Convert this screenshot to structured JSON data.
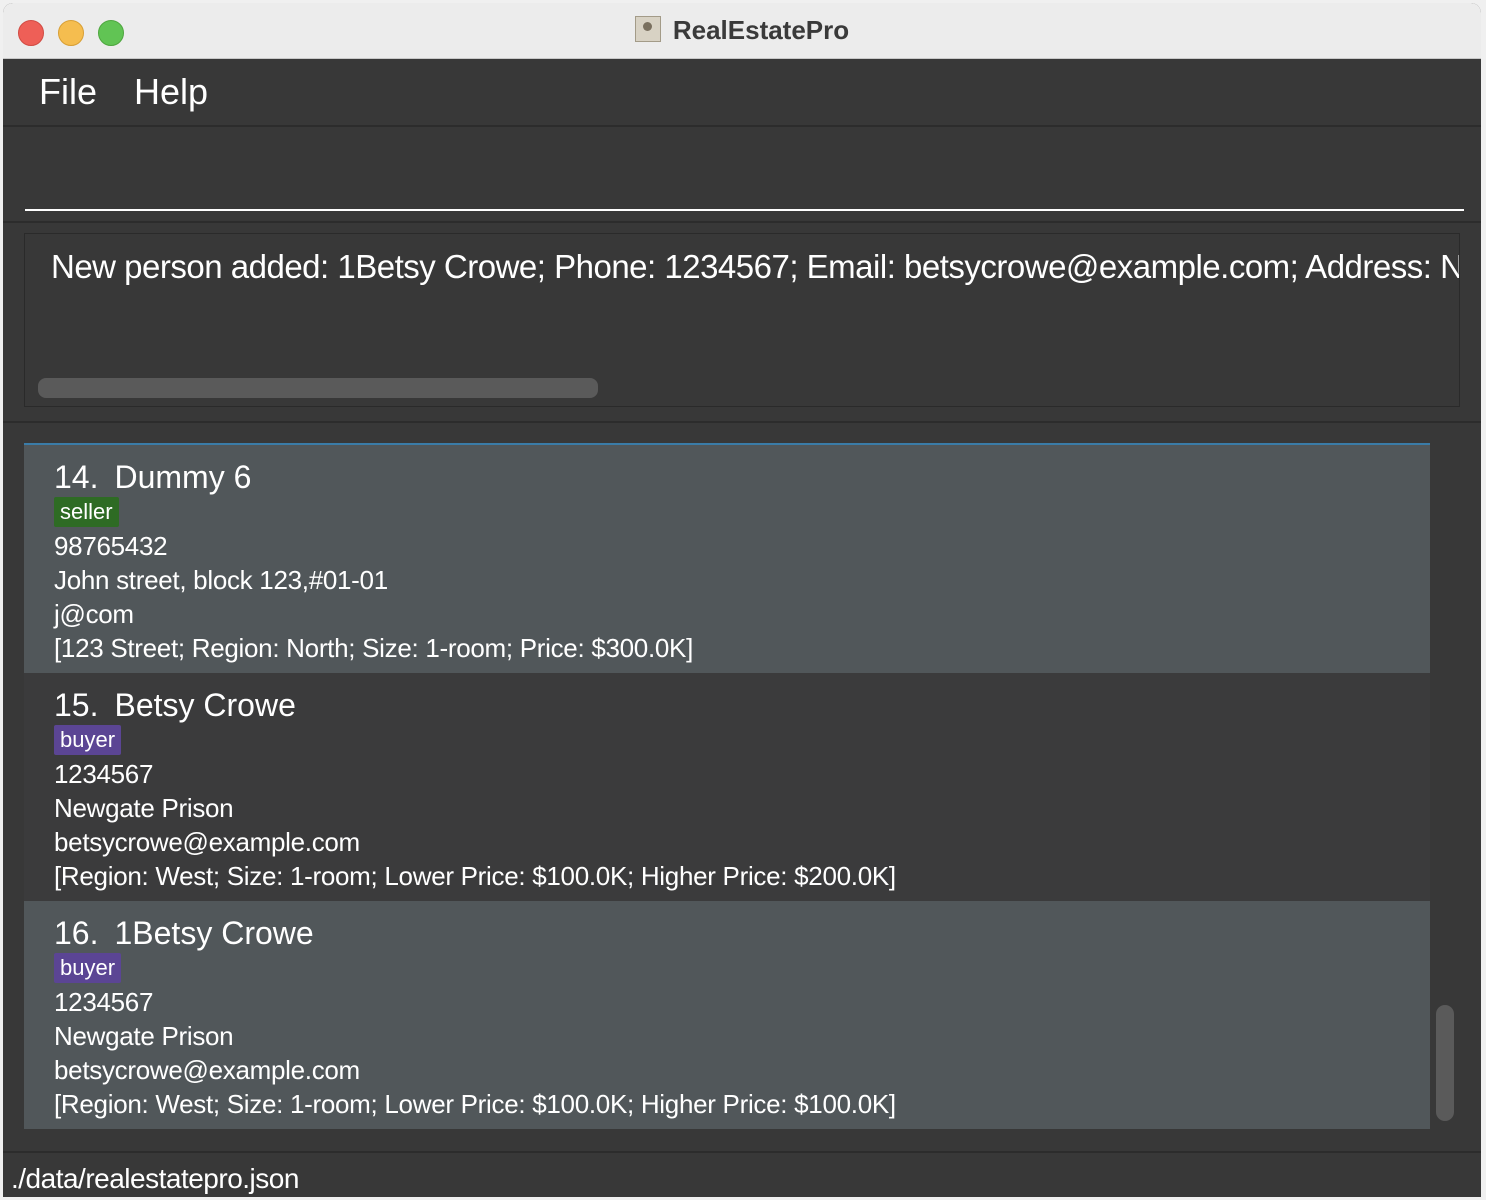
{
  "window": {
    "title": "RealEstatePro"
  },
  "menu": {
    "items": [
      "File",
      "Help"
    ]
  },
  "command": {
    "value": "",
    "placeholder": ""
  },
  "result": {
    "text": "New person added: 1Betsy Crowe; Phone: 1234567; Email: betsycrowe@example.com; Address: Newgate Prison"
  },
  "persons": [
    {
      "index": "14.",
      "name": "Dummy 6",
      "tag": "seller",
      "phone": "98765432",
      "address": "John street, block 123,#01-01",
      "email": "j@com",
      "details": "[123 Street; Region: North; Size: 1-room; Price: $300.0K]"
    },
    {
      "index": "15.",
      "name": "Betsy Crowe",
      "tag": "buyer",
      "phone": "1234567",
      "address": "Newgate Prison",
      "email": "betsycrowe@example.com",
      "details": "[Region: West; Size: 1-room; Lower Price: $100.0K; Higher Price: $200.0K]"
    },
    {
      "index": "16.",
      "name": "1Betsy Crowe",
      "tag": "buyer",
      "phone": "1234567",
      "address": "Newgate Prison",
      "email": "betsycrowe@example.com",
      "details": "[Region: West; Size: 1-room; Lower Price: $100.0K; Higher Price: $100.0K]"
    }
  ],
  "status": {
    "path": "./data/realestatepro.json"
  },
  "colors": {
    "window_bg": "#383838",
    "card_odd": "#51575a",
    "card_even": "#3b3b3c",
    "seller_tag": "#2e6b24",
    "buyer_tag": "#5b4594",
    "list_focus": "#3a7ca8"
  }
}
